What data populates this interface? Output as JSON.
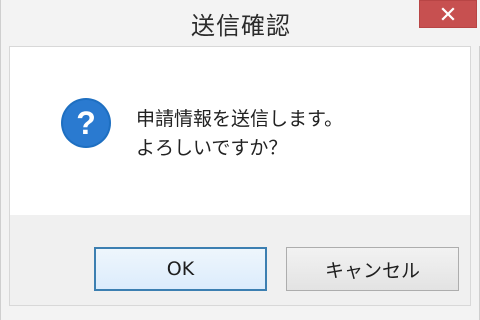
{
  "window": {
    "title": "送信確認"
  },
  "message": {
    "line1": "申請情報を送信します。",
    "line2": "よろしいですか？",
    "icon": "question-icon"
  },
  "buttons": {
    "ok_label": "OK",
    "cancel_label": "キャンセル"
  },
  "colors": {
    "close_button": "#c75050",
    "icon_fill": "#1e6fc1",
    "default_button_border": "#3c7fb1"
  }
}
